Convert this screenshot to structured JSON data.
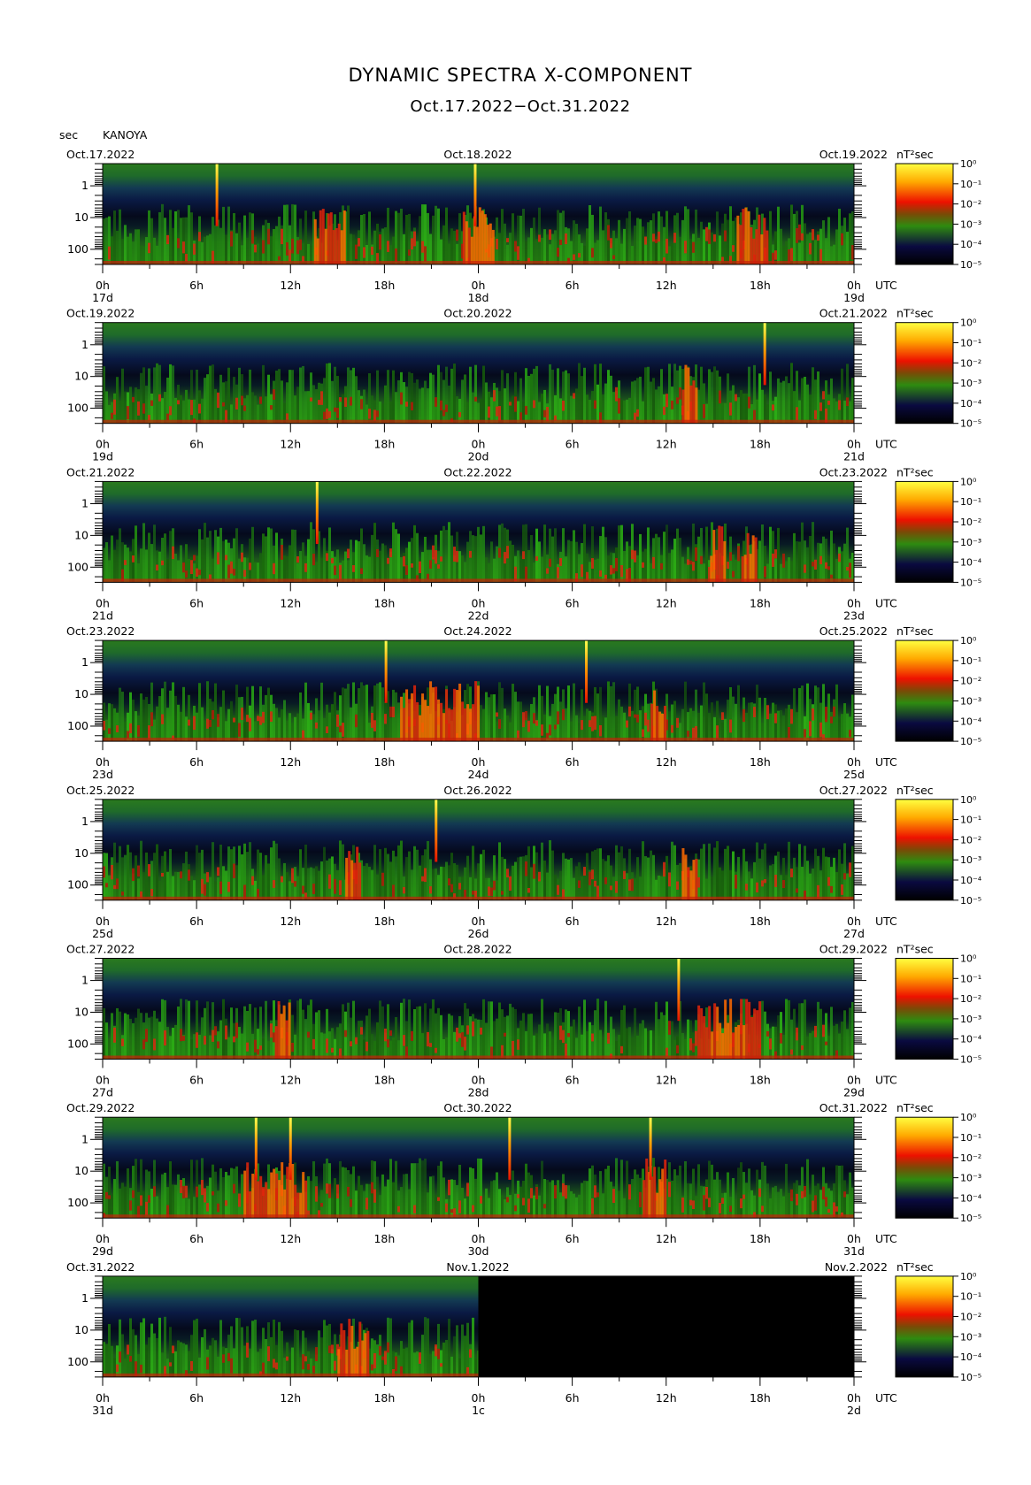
{
  "chart_data": {
    "type": "heatmap",
    "title": "DYNAMIC SPECTRA X-COMPONENT",
    "subtitle": "Oct.17.2022−Oct.31.2022",
    "station": "KANOYA",
    "y_unit": "sec",
    "y_ticks": [
      "1",
      "10",
      "100"
    ],
    "y_scale": "log",
    "y_range": [
      0.2,
      300
    ],
    "x_ticks": [
      "0h",
      "6h",
      "12h",
      "18h",
      "0h",
      "6h",
      "12h",
      "18h",
      "0h"
    ],
    "x_hours_range": [
      0,
      48
    ],
    "utc_label": "UTC",
    "colorbar_unit": "nT²sec",
    "colorbar_ticks": [
      "10⁰",
      "10⁻¹",
      "10⁻²",
      "10⁻³",
      "10⁻⁴",
      "10⁻⁵"
    ],
    "colorbar_colors": [
      "#ffff40",
      "#ffaa00",
      "#ee1100",
      "#2e8b10",
      "#0a0a40",
      "#000000"
    ],
    "panels": [
      {
        "start": "Oct.17.2022",
        "mid": "Oct.18.2022",
        "end": "Oct.19.2022",
        "d0": "17d",
        "d1": "18d",
        "d2": "19d",
        "spikes": [
          7.3,
          23.8
        ],
        "bursts": [
          [
            13.5,
            15.5
          ],
          [
            23.0,
            25.0
          ],
          [
            40.5,
            42.5
          ]
        ],
        "missing_after_hours": null
      },
      {
        "start": "Oct.19.2022",
        "mid": "Oct.20.2022",
        "end": "Oct.21.2022",
        "d0": "19d",
        "d1": "20d",
        "d2": "21d",
        "spikes": [
          42.3
        ],
        "bursts": [
          [
            37.0,
            38.0
          ]
        ],
        "missing_after_hours": null
      },
      {
        "start": "Oct.21.2022",
        "mid": "Oct.22.2022",
        "end": "Oct.23.2022",
        "d0": "21d",
        "d1": "22d",
        "d2": "23d",
        "spikes": [
          13.7
        ],
        "bursts": [
          [
            38.8,
            39.8
          ],
          [
            40.8,
            41.8
          ]
        ],
        "missing_after_hours": null
      },
      {
        "start": "Oct.23.2022",
        "mid": "Oct.24.2022",
        "end": "Oct.25.2022",
        "d0": "23d",
        "d1": "24d",
        "d2": "25d",
        "spikes": [
          18.1,
          30.9
        ],
        "bursts": [
          [
            19.0,
            24.0
          ],
          [
            35.0,
            36.0
          ]
        ],
        "missing_after_hours": null
      },
      {
        "start": "Oct.25.2022",
        "mid": "Oct.26.2022",
        "end": "Oct.27.2022",
        "d0": "25d",
        "d1": "26d",
        "d2": "27d",
        "spikes": [
          21.3
        ],
        "bursts": [
          [
            15.5,
            16.5
          ],
          [
            37.0,
            38.0
          ]
        ],
        "missing_after_hours": null
      },
      {
        "start": "Oct.27.2022",
        "mid": "Oct.28.2022",
        "end": "Oct.29.2022",
        "d0": "27d",
        "d1": "28d",
        "d2": "29d",
        "spikes": [
          36.8
        ],
        "bursts": [
          [
            11.0,
            12.0
          ],
          [
            38.0,
            42.0
          ]
        ],
        "missing_after_hours": null
      },
      {
        "start": "Oct.29.2022",
        "mid": "Oct.30.2022",
        "end": "Oct.31.2022",
        "d0": "29d",
        "d1": "30d",
        "d2": "31d",
        "spikes": [
          9.8,
          12.0,
          26.0,
          35.0
        ],
        "bursts": [
          [
            9.0,
            13.0
          ],
          [
            34.5,
            36.0
          ]
        ],
        "missing_after_hours": null
      },
      {
        "start": "Oct.31.2022",
        "mid": "Nov.1.2022",
        "end": "Nov.2.2022",
        "d0": "31d",
        "d1": "1c",
        "d2": "2d",
        "spikes": [],
        "bursts": [
          [
            15.0,
            17.0
          ]
        ],
        "missing_after_hours": 24
      }
    ]
  }
}
